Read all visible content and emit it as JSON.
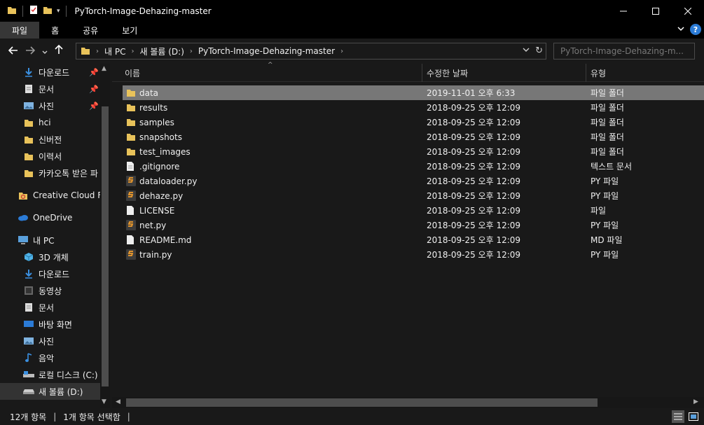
{
  "window": {
    "title": "PyTorch-Image-Dehazing-master"
  },
  "ribbon": {
    "tabs": [
      "파일",
      "홈",
      "공유",
      "보기"
    ]
  },
  "address": {
    "crumbs": [
      "내 PC",
      "새 볼륨 (D:)",
      "PyTorch-Image-Dehazing-master"
    ],
    "search_placeholder": "PyTorch-Image-Dehazing-m..."
  },
  "sidebar": {
    "items": [
      {
        "label": "다운로드",
        "icon": "download-icon",
        "pinned": true
      },
      {
        "label": "문서",
        "icon": "document-icon",
        "pinned": true
      },
      {
        "label": "사진",
        "icon": "pictures-icon",
        "pinned": true
      },
      {
        "label": "hci",
        "icon": "folder-icon"
      },
      {
        "label": "신버전",
        "icon": "folder-icon"
      },
      {
        "label": "이력서",
        "icon": "folder-icon"
      },
      {
        "label": "카카오톡 받은 파",
        "icon": "folder-icon"
      },
      {
        "label": "Creative Cloud Fil",
        "icon": "creative-cloud-icon"
      },
      {
        "label": "OneDrive",
        "icon": "onedrive-icon"
      },
      {
        "label": "내 PC",
        "icon": "pc-icon"
      },
      {
        "label": "3D 개체",
        "icon": "3d-objects-icon"
      },
      {
        "label": "다운로드",
        "icon": "download-icon"
      },
      {
        "label": "동영상",
        "icon": "video-icon"
      },
      {
        "label": "문서",
        "icon": "document-icon"
      },
      {
        "label": "바탕 화면",
        "icon": "desktop-icon"
      },
      {
        "label": "사진",
        "icon": "pictures-icon"
      },
      {
        "label": "음악",
        "icon": "music-icon"
      },
      {
        "label": "로컬 디스크 (C:)",
        "icon": "local-disk-icon"
      },
      {
        "label": "새 볼륨 (D:)",
        "icon": "drive-icon"
      }
    ]
  },
  "columns": {
    "name": "이름",
    "date": "수정한 날짜",
    "type": "유형"
  },
  "files": [
    {
      "name": "data",
      "date": "2019-11-01 오후 6:33",
      "type": "파일 폴더",
      "icon": "folder-icon"
    },
    {
      "name": "results",
      "date": "2018-09-25 오후 12:09",
      "type": "파일 폴더",
      "icon": "folder-icon"
    },
    {
      "name": "samples",
      "date": "2018-09-25 오후 12:09",
      "type": "파일 폴더",
      "icon": "folder-icon"
    },
    {
      "name": "snapshots",
      "date": "2018-09-25 오후 12:09",
      "type": "파일 폴더",
      "icon": "folder-icon"
    },
    {
      "name": "test_images",
      "date": "2018-09-25 오후 12:09",
      "type": "파일 폴더",
      "icon": "folder-icon"
    },
    {
      "name": ".gitignore",
      "date": "2018-09-25 오후 12:09",
      "type": "텍스트 문서",
      "icon": "text-file-icon"
    },
    {
      "name": "dataloader.py",
      "date": "2018-09-25 오후 12:09",
      "type": "PY 파일",
      "icon": "python-file-icon"
    },
    {
      "name": "dehaze.py",
      "date": "2018-09-25 오후 12:09",
      "type": "PY 파일",
      "icon": "python-file-icon"
    },
    {
      "name": "LICENSE",
      "date": "2018-09-25 오후 12:09",
      "type": "파일",
      "icon": "file-icon"
    },
    {
      "name": "net.py",
      "date": "2018-09-25 오후 12:09",
      "type": "PY 파일",
      "icon": "python-file-icon"
    },
    {
      "name": "README.md",
      "date": "2018-09-25 오후 12:09",
      "type": "MD 파일",
      "icon": "file-icon"
    },
    {
      "name": "train.py",
      "date": "2018-09-25 오후 12:09",
      "type": "PY 파일",
      "icon": "python-file-icon"
    }
  ],
  "status": {
    "count": "12개 항목",
    "selected": "1개 항목 선택함"
  },
  "colors": {
    "folder": "#e8c25a",
    "accent": "#2b7bd6",
    "selected_row": "#777777"
  }
}
